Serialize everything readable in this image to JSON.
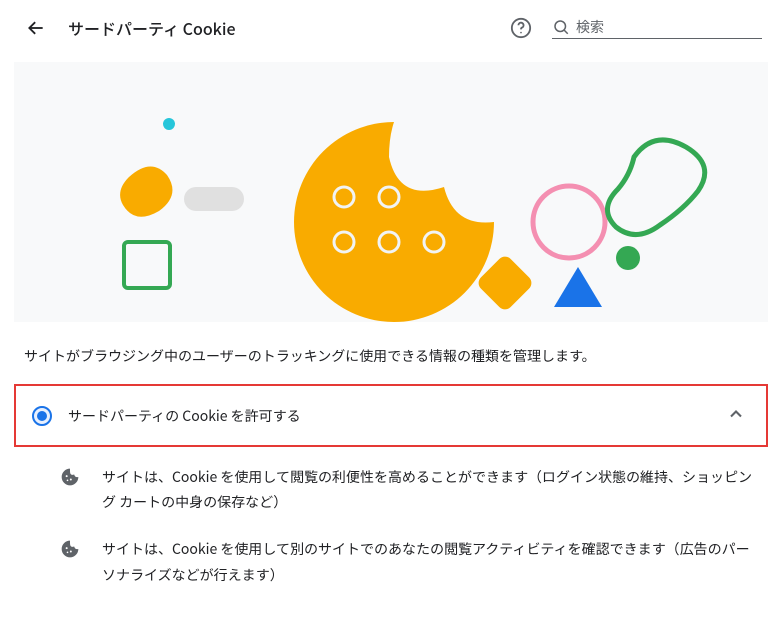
{
  "header": {
    "title": "サードパーティ Cookie",
    "search_placeholder": "検索"
  },
  "description": "サイトがブラウジング中のユーザーのトラッキングに使用できる情報の種類を管理します。",
  "option": {
    "label": "サードパーティの Cookie を許可する"
  },
  "bullets": [
    "サイトは、Cookie を使用して閲覧の利便性を高めることができます（ログイン状態の維持、ショッピング カートの中身の保存など）",
    "サイトは、Cookie を使用して別のサイトでのあなたの閲覧アクティビティを確認できます（広告のパーソナライズなどが行えます）"
  ]
}
